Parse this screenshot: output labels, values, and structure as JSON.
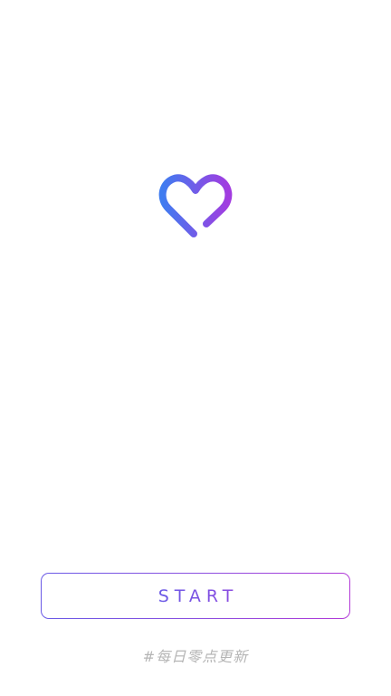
{
  "logo": {
    "icon": "heart-icon",
    "gradient_start": "#3f7cf0",
    "gradient_end": "#a23ce0"
  },
  "start_button": {
    "label": "START",
    "border_gradient": [
      "#6a5ae6",
      "#b23ad8"
    ]
  },
  "footer": {
    "note": "#每日零点更新"
  },
  "colors": {
    "background": "#ffffff",
    "footer_text": "#b5b5b5"
  }
}
